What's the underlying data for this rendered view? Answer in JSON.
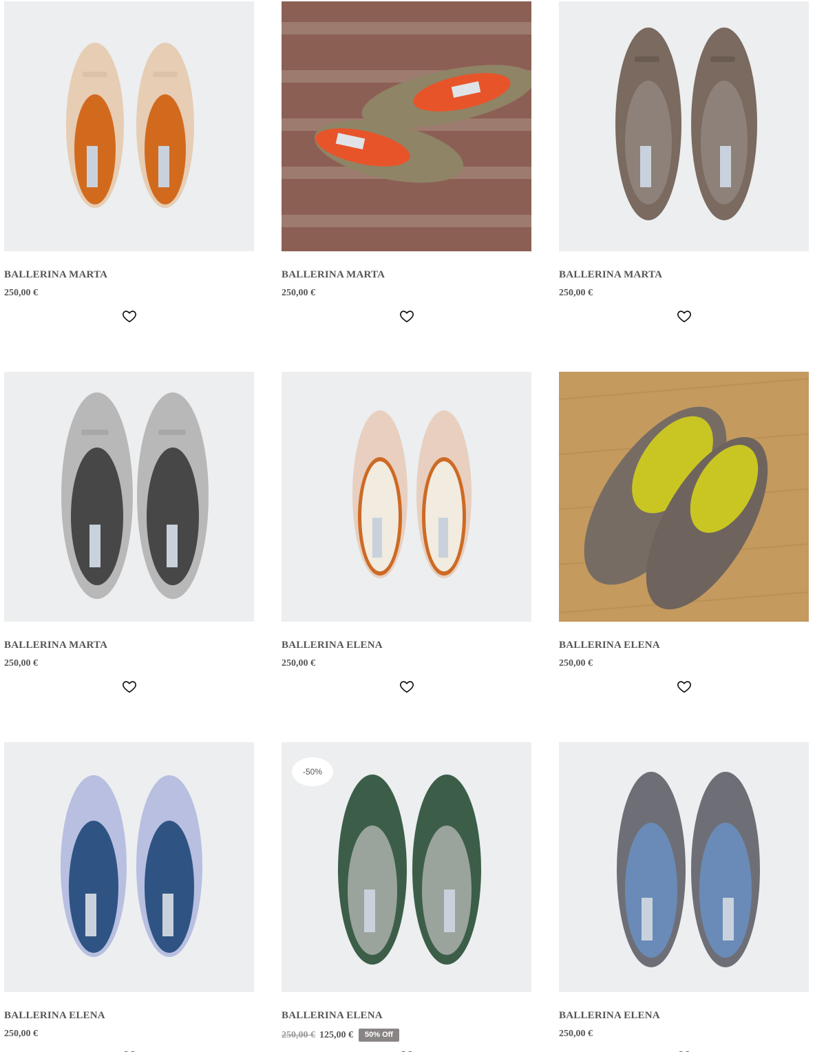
{
  "products": [
    {
      "name": "BALLERINA MARTA",
      "price": "250,00 €"
    },
    {
      "name": "BALLERINA MARTA",
      "price": "250,00 €"
    },
    {
      "name": "BALLERINA MARTA",
      "price": "250,00 €"
    },
    {
      "name": "BALLERINA MARTA",
      "price": "250,00 €"
    },
    {
      "name": "BALLERINA ELENA",
      "price": "250,00 €"
    },
    {
      "name": "BALLERINA ELENA",
      "price": "250,00 €"
    },
    {
      "name": "BALLERINA ELENA",
      "price": "250,00 €"
    },
    {
      "name": "BALLERINA ELENA",
      "old_price": "250,00 €",
      "price": "125,00 €",
      "sale_pill": "50% Off",
      "discount_badge": "-50%"
    },
    {
      "name": "BALLERINA ELENA",
      "price": "250,00 €"
    }
  ],
  "icons": {
    "wishlist": "heart-outline-icon"
  },
  "colors": {
    "sale_pill_bg": "#8a8585",
    "text": "#555555"
  }
}
